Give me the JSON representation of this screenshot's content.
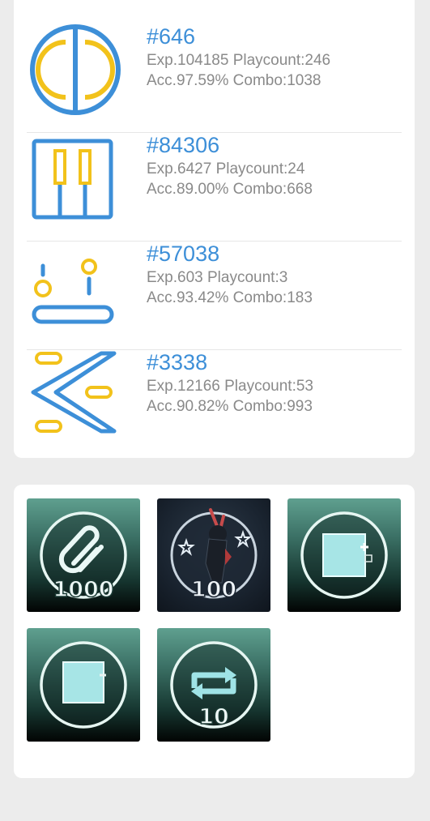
{
  "modes": [
    {
      "icon": "key-mode-icon",
      "rank": "#646",
      "exp_line": "Exp.104185 Playcount:246",
      "acc_line": "Acc.97.59% Combo:1038"
    },
    {
      "icon": "piano-mode-icon",
      "rank": "#84306",
      "exp_line": "Exp.6427 Playcount:24",
      "acc_line": "Acc.89.00% Combo:668"
    },
    {
      "icon": "catch-mode-icon",
      "rank": "#57038",
      "exp_line": "Exp.603 Playcount:3",
      "acc_line": "Acc.93.42% Combo:183"
    },
    {
      "icon": "slide-mode-icon",
      "rank": "#3338",
      "exp_line": "Exp.12166 Playcount:53",
      "acc_line": "Acc.90.82% Combo:993"
    }
  ],
  "medals": [
    {
      "icon": "paperclip-icon",
      "label": "1000"
    },
    {
      "icon": "character-icon",
      "label": "100"
    },
    {
      "icon": "puzzle-block-icon",
      "label": ""
    },
    {
      "icon": "block-icon",
      "label": ""
    },
    {
      "icon": "repeat-icon",
      "label": "10"
    }
  ],
  "colors": {
    "blue": "#3d8fd8",
    "yellow": "#f2c21b",
    "gray_text": "#8a8a8a"
  }
}
